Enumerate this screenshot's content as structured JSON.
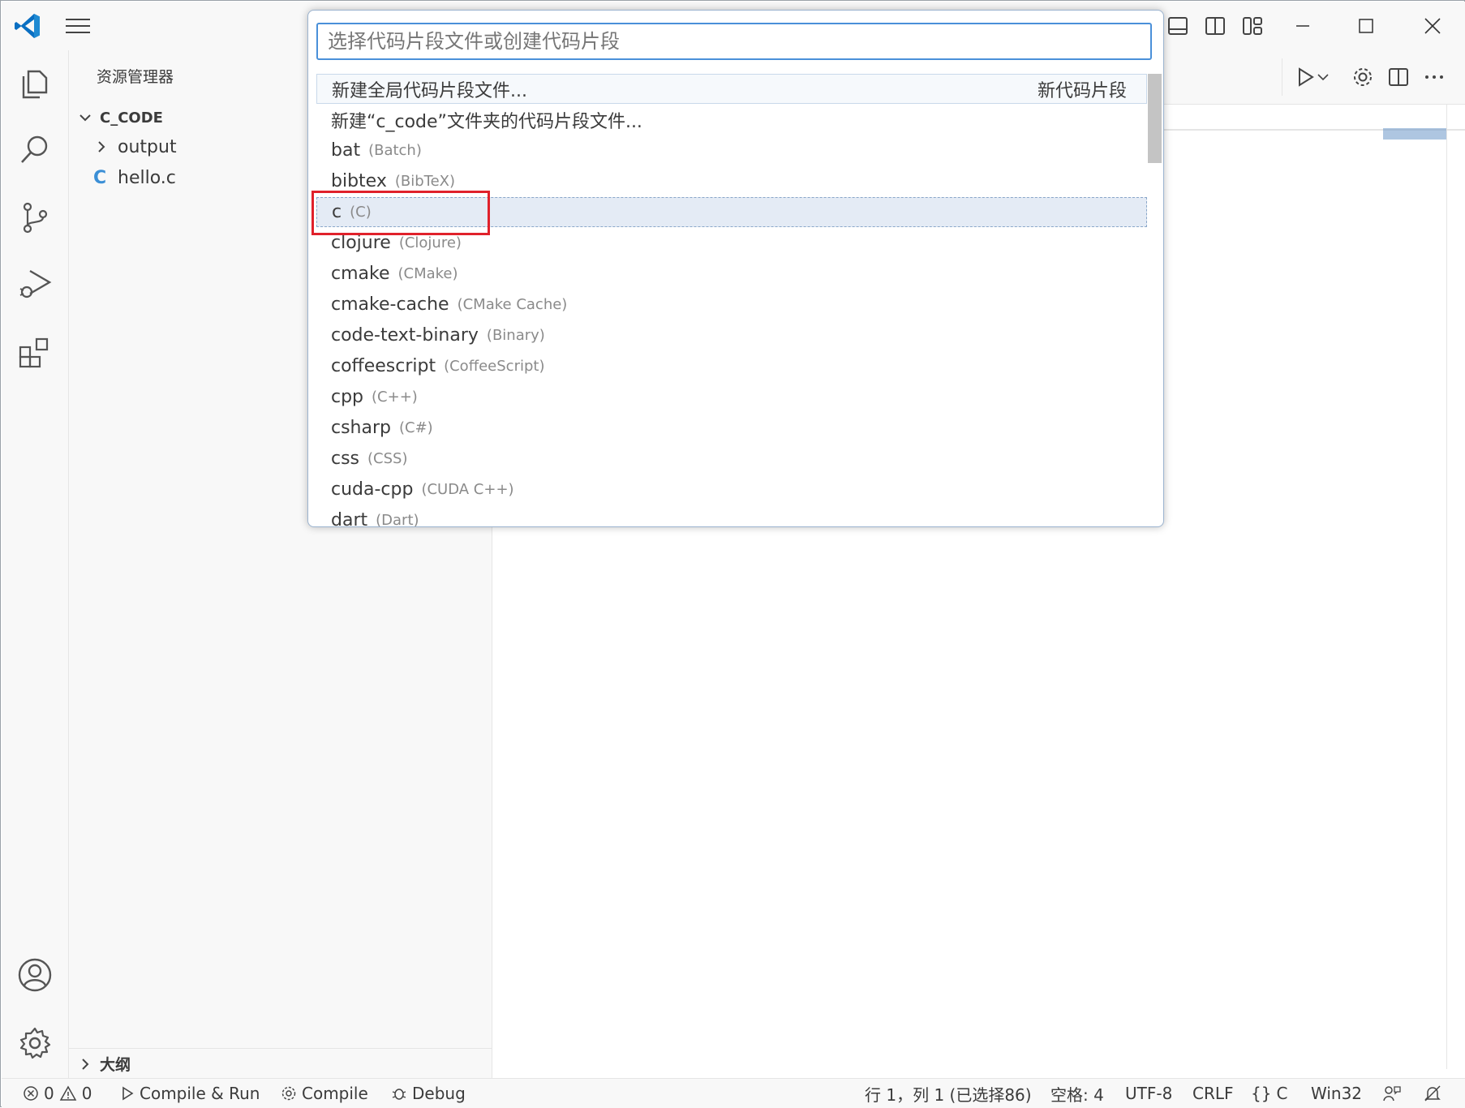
{
  "sidebar": {
    "title": "资源管理器",
    "root": "C_CODE",
    "items": [
      {
        "label": "output",
        "type": "folder"
      },
      {
        "label": "hello.c",
        "type": "c-file",
        "icon_letter": "C"
      }
    ],
    "outline": "大纲"
  },
  "quick_pick": {
    "placeholder": "选择代码片段文件或创建代码片段",
    "items": [
      {
        "label": "新建全局代码片段文件...",
        "description": "",
        "right": "新代码片段"
      },
      {
        "label": "新建“c_code”文件夹的代码片段文件...",
        "description": "",
        "right": ""
      },
      {
        "label": "bat",
        "description": "(Batch)",
        "right": ""
      },
      {
        "label": "bibtex",
        "description": "(BibTeX)",
        "right": ""
      },
      {
        "label": "c",
        "description": "(C)",
        "right": ""
      },
      {
        "label": "clojure",
        "description": "(Clojure)",
        "right": ""
      },
      {
        "label": "cmake",
        "description": "(CMake)",
        "right": ""
      },
      {
        "label": "cmake-cache",
        "description": "(CMake Cache)",
        "right": ""
      },
      {
        "label": "code-text-binary",
        "description": "(Binary)",
        "right": ""
      },
      {
        "label": "coffeescript",
        "description": "(CoffeeScript)",
        "right": ""
      },
      {
        "label": "cpp",
        "description": "(C++)",
        "right": ""
      },
      {
        "label": "csharp",
        "description": "(C#)",
        "right": ""
      },
      {
        "label": "css",
        "description": "(CSS)",
        "right": ""
      },
      {
        "label": "cuda-cpp",
        "description": "(CUDA C++)",
        "right": ""
      },
      {
        "label": "dart",
        "description": "(Dart)",
        "right": ""
      }
    ]
  },
  "statusbar": {
    "errors": "0",
    "warnings": "0",
    "compile_run": "Compile & Run",
    "compile": "Compile",
    "debug": "Debug",
    "position": "行 1，列 1 (已选择86)",
    "spaces": "空格: 4",
    "encoding": "UTF-8",
    "eol": "CRLF",
    "language": "C",
    "platform": "Win32"
  },
  "colors": {
    "accent": "#007acc",
    "highlight": "#e0212b",
    "c_icon": "#3b8fd6"
  }
}
